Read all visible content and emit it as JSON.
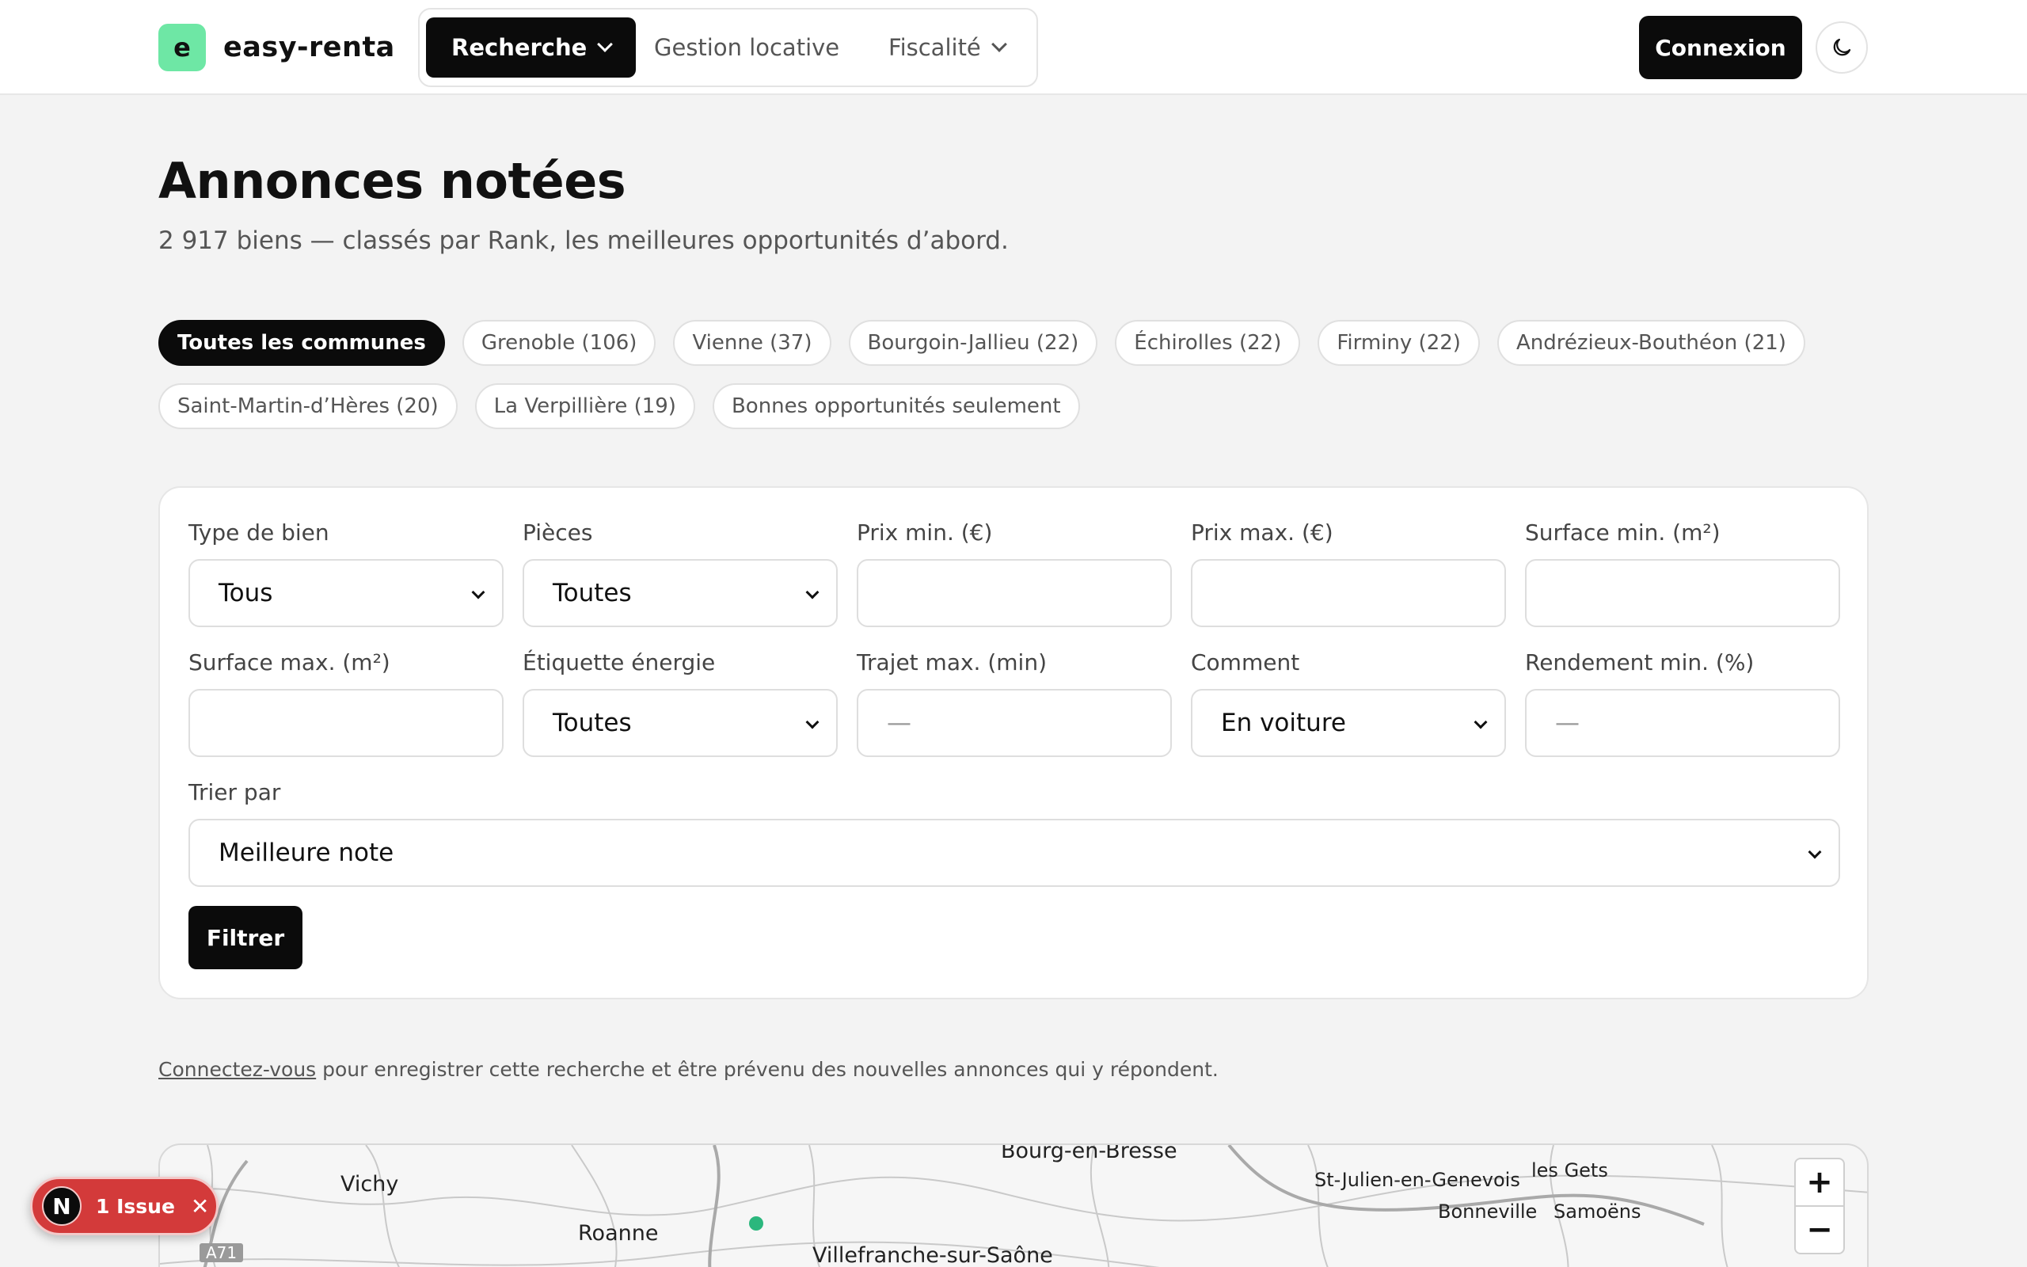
{
  "brand": {
    "logo_letter": "e",
    "name": "easy-renta",
    "logo_color": "#6ee7a5"
  },
  "nav": {
    "items": [
      {
        "label": "Recherche",
        "active": true
      },
      {
        "label": "Gestion locative",
        "active": false
      },
      {
        "label": "Fiscalité",
        "active": false
      }
    ],
    "login_label": "Connexion",
    "theme_icon": "moon-icon"
  },
  "page": {
    "title": "Annonces notées",
    "subtitle": "2 917 biens — classés par Rank, les meilleures opportunités d’abord."
  },
  "chips": {
    "row1": [
      "Toutes les communes",
      "Grenoble (106)",
      "Vienne (37)",
      "Bourgoin-Jallieu (22)",
      "Échirolles (22)",
      "Firminy (22)",
      "Andrézieux-Bouthéon (21)"
    ],
    "row2": [
      "Saint-Martin-d’Hères (20)",
      "La Verpillière (19)",
      "Bonnes opportunités seulement"
    ],
    "active": "Toutes les communes"
  },
  "filters": {
    "type_label": "Type de bien",
    "type_value": "Tous",
    "rooms_label": "Pièces",
    "rooms_value": "Toutes",
    "price_min_label": "Prix min. (€)",
    "price_max_label": "Prix max. (€)",
    "surface_min_label": "Surface min. (m²)",
    "surface_max_label": "Surface max. (m²)",
    "energy_label": "Étiquette énergie",
    "energy_value": "Toutes",
    "commute_label": "Trajet max. (min)",
    "commute_placeholder": "—",
    "mode_label": "Comment",
    "mode_value": "En voiture",
    "yield_label": "Rendement min. (%)",
    "yield_placeholder": "—",
    "sort_label": "Trier par",
    "sort_value": "Meilleure note",
    "submit_label": "Filtrer"
  },
  "notice": {
    "link": "Connectez-vous",
    "text": " pour enregistrer cette recherche et être prévenu des nouvelles annonces qui y répondent."
  },
  "map": {
    "places": [
      "Bourg-en-Bresse",
      "Vichy",
      "Roanne",
      "Villefranche-sur-Saône",
      "St-Julien-en-Genevois",
      "les Gets",
      "Bonneville",
      "Samoëns"
    ],
    "road": "A71",
    "marker_color": "#2bb77d",
    "zoom_in": "+",
    "zoom_out": "−"
  },
  "issue_badge": {
    "letter": "N",
    "label": "1 Issue",
    "close": "✕",
    "color": "#d33a3a"
  }
}
